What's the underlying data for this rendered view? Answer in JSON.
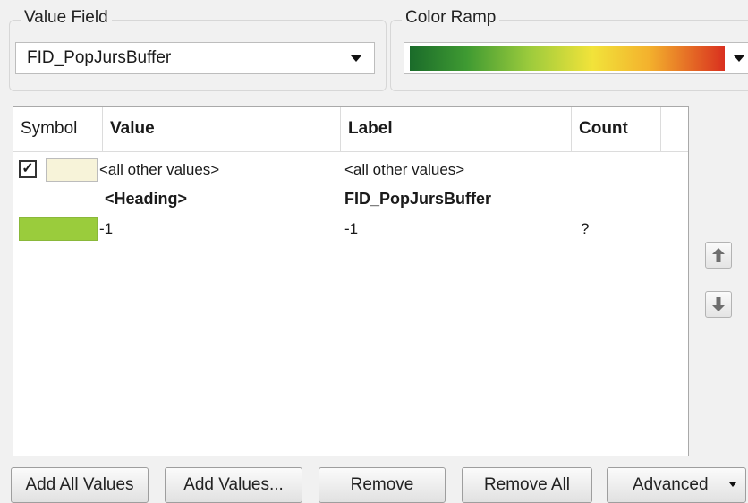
{
  "value_field": {
    "legend": "Value Field",
    "selected": "FID_PopJursBuffer"
  },
  "color_ramp": {
    "legend": "Color Ramp"
  },
  "table": {
    "columns": [
      "Symbol",
      "Value",
      "Label",
      "Count"
    ],
    "rows": [
      {
        "checked": true,
        "value": "<all other values>",
        "label": "<all other values>",
        "count": "",
        "swatch_color": "#f7f3d9"
      },
      {
        "value": "<Heading>",
        "label": "FID_PopJursBuffer",
        "count": ""
      },
      {
        "value": "-1",
        "label": "-1",
        "count": "?",
        "swatch_color": "#9acc3c"
      }
    ]
  },
  "buttons": {
    "add_all_values": "Add All Values",
    "add_values": "Add Values...",
    "remove": "Remove",
    "remove_all": "Remove All",
    "advanced": "Advanced"
  },
  "icons": [
    "move-up-icon",
    "move-down-icon",
    "dropdown-arrow-icon",
    "check-icon"
  ]
}
